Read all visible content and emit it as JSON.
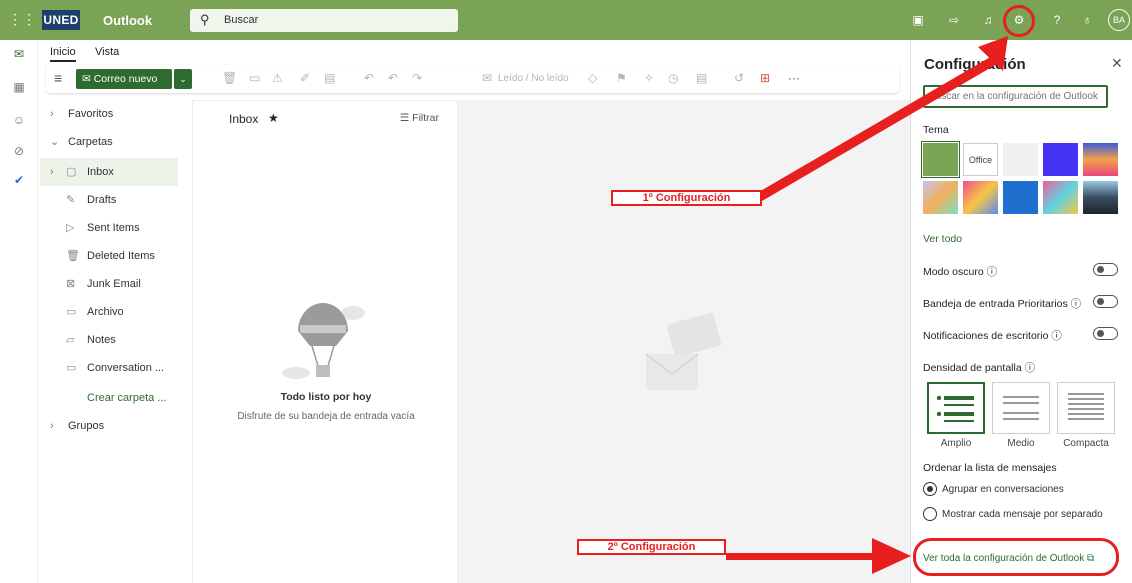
{
  "topbar": {
    "app_name": "Outlook",
    "logo_text": "UNED",
    "search_placeholder": "Buscar",
    "avatar_initials": "BA"
  },
  "nav_tabs": {
    "home": "Inicio",
    "view": "Vista"
  },
  "ribbon": {
    "new_mail": "Correo nuevo",
    "read_unread": "Leído / No leído",
    "more": "···"
  },
  "folders": {
    "favorites": "Favoritos",
    "folders_header": "Carpetas",
    "items": [
      {
        "label": "Inbox"
      },
      {
        "label": "Drafts"
      },
      {
        "label": "Sent Items"
      },
      {
        "label": "Deleted Items"
      },
      {
        "label": "Junk Email"
      },
      {
        "label": "Archivo"
      },
      {
        "label": "Notes"
      },
      {
        "label": "Conversation ..."
      }
    ],
    "create_folder": "Crear carpeta ...",
    "groups": "Grupos"
  },
  "mail_list": {
    "header": "Inbox",
    "filter": "Filtrar",
    "empty_title": "Todo listo por hoy",
    "empty_subtitle": "Disfrute de su bandeja de entrada vacía"
  },
  "settings": {
    "title": "Configuración",
    "search_placeholder": "Buscar en la configuración de Outlook",
    "theme_label": "Tema",
    "office_swatch": "Office",
    "see_all": "Ver todo",
    "dark_mode": "Modo oscuro",
    "focused_inbox": "Bandeja de entrada Prioritarios",
    "desktop_notifications": "Notificaciones de escritorio",
    "density_label": "Densidad de pantalla",
    "density_options": [
      "Amplio",
      "Medio",
      "Compacta"
    ],
    "sort_label": "Ordenar la lista de mensajes",
    "sort_options": [
      "Agrupar en conversaciones",
      "Mostrar cada mensaje por separado"
    ],
    "view_all_settings": "Ver toda la configuración de Outlook"
  },
  "annotations": {
    "first": "1º Configuración",
    "second": "2º Configuración"
  },
  "colors": {
    "header_green": "#7aa355",
    "accent_green": "#2e6b31",
    "annotation_red": "#e81f1f"
  }
}
